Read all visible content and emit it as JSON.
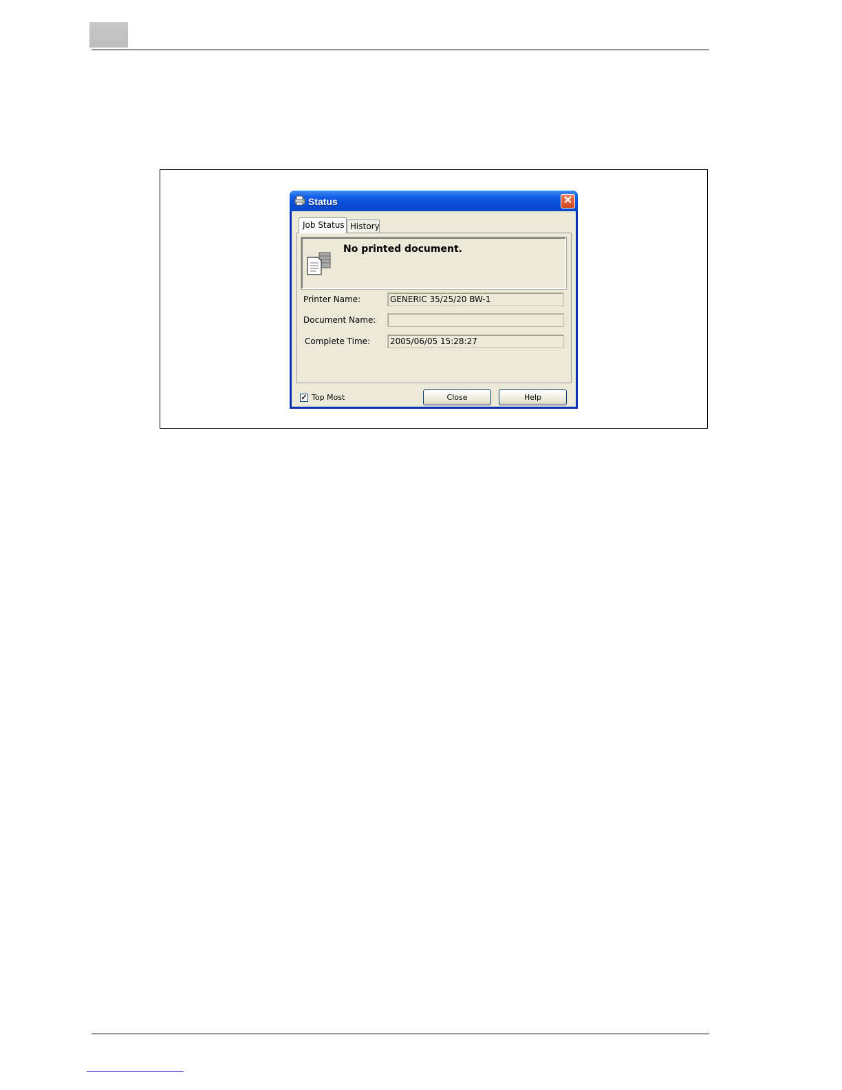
{
  "dialog": {
    "title": "Status",
    "tabs": [
      {
        "label": "Job Status",
        "active": true
      },
      {
        "label": "History",
        "active": false
      }
    ],
    "message": "No printed document.",
    "fields": [
      {
        "label": "Printer Name:",
        "value": "GENERIC 35/25/20 BW-1"
      },
      {
        "label": "Document Name:",
        "value": ""
      },
      {
        "label": "Complete Time:",
        "value": "2005/06/05 15:28:27"
      }
    ],
    "top_most": {
      "label": "Top Most",
      "checked": true
    },
    "buttons": {
      "close": "Close",
      "help": "Help"
    },
    "close_glyph": "✕"
  },
  "colors": {
    "titlebar": "#0a4fd8",
    "window_face": "#ece9d8",
    "close_button": "#d8411d"
  },
  "icons": {
    "title": "printer-status-icon",
    "message": "document-printer-icon",
    "close": "close-icon"
  }
}
